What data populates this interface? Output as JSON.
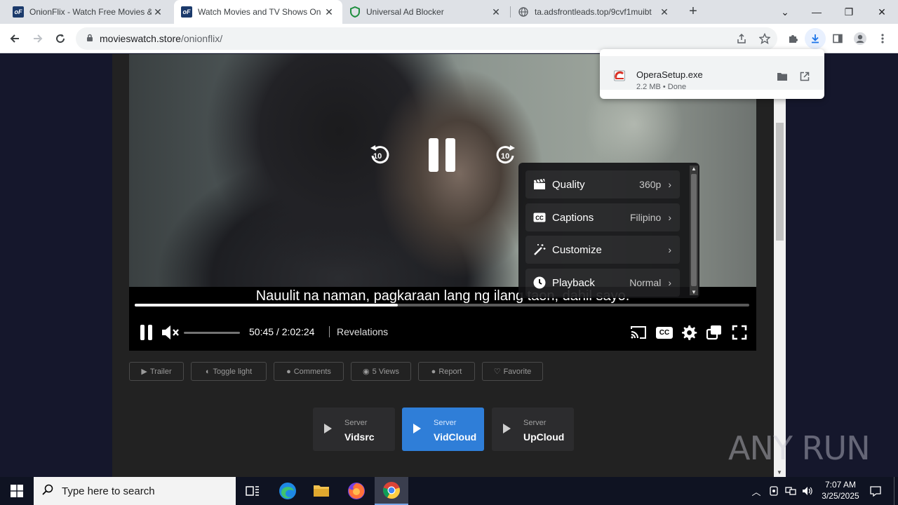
{
  "browser": {
    "tabs": [
      {
        "title": "OnionFlix - Watch Free Movies & ",
        "favicon": "onionflix-icon",
        "active": false
      },
      {
        "title": "Watch Movies and TV Shows On",
        "favicon": "onionflix-icon",
        "active": true
      },
      {
        "title": "Universal Ad Blocker",
        "favicon": "shield-icon",
        "active": false
      },
      {
        "title": "ta.adsfrontleads.top/9cvf1muibt",
        "favicon": "globe-icon",
        "active": false
      }
    ],
    "favicon_text": "oF",
    "url_host": "movieswatch.store",
    "url_path": "/onionflix/"
  },
  "download": {
    "filename": "OperaSetup.exe",
    "meta": "2.2 MB • Done"
  },
  "player": {
    "subtitle": "Nauulit na naman, pagkaraan lang ng ilang taon, dahil sayo.",
    "current_time": "50:45",
    "duration": "2:02:24",
    "time_display": "50:45 / 2:02:24",
    "chapter": "Revelations",
    "progress_fraction": 0.428,
    "buffered_fraction": 0.428,
    "volume_fraction": 0,
    "muted": true,
    "skip_back_label": "10",
    "skip_fwd_label": "10",
    "cc_label": "CC",
    "settings_menu": [
      {
        "label": "Quality",
        "value": "360p",
        "icon": "clapperboard-icon"
      },
      {
        "label": "Captions",
        "value": "Filipino",
        "icon": "cc-icon"
      },
      {
        "label": "Customize",
        "value": "",
        "icon": "magic-wand-icon"
      },
      {
        "label": "Playback",
        "value": "Normal",
        "icon": "clock-icon"
      }
    ]
  },
  "actions": [
    {
      "label": "Trailer",
      "icon": "youtube-icon"
    },
    {
      "label": "Toggle light",
      "icon": "lightbulb-icon"
    },
    {
      "label": "Comments",
      "icon": "comment-icon"
    },
    {
      "label": "5 Views",
      "icon": "eye-icon"
    },
    {
      "label": "Report",
      "icon": "alert-icon"
    },
    {
      "label": "Favorite",
      "icon": "heart-icon"
    }
  ],
  "servers": [
    {
      "small": "Server",
      "name": "Vidsrc",
      "active": false
    },
    {
      "small": "Server",
      "name": "VidCloud",
      "active": true
    },
    {
      "small": "Server",
      "name": "UpCloud",
      "active": false
    }
  ],
  "watermark": "ANY RUN",
  "taskbar": {
    "search_placeholder": "Type here to search",
    "time": "7:07 AM",
    "date": "3/25/2025"
  },
  "colors": {
    "accent": "#2f7ed8",
    "page_bg": "#15172c",
    "content_bg": "#222222"
  }
}
